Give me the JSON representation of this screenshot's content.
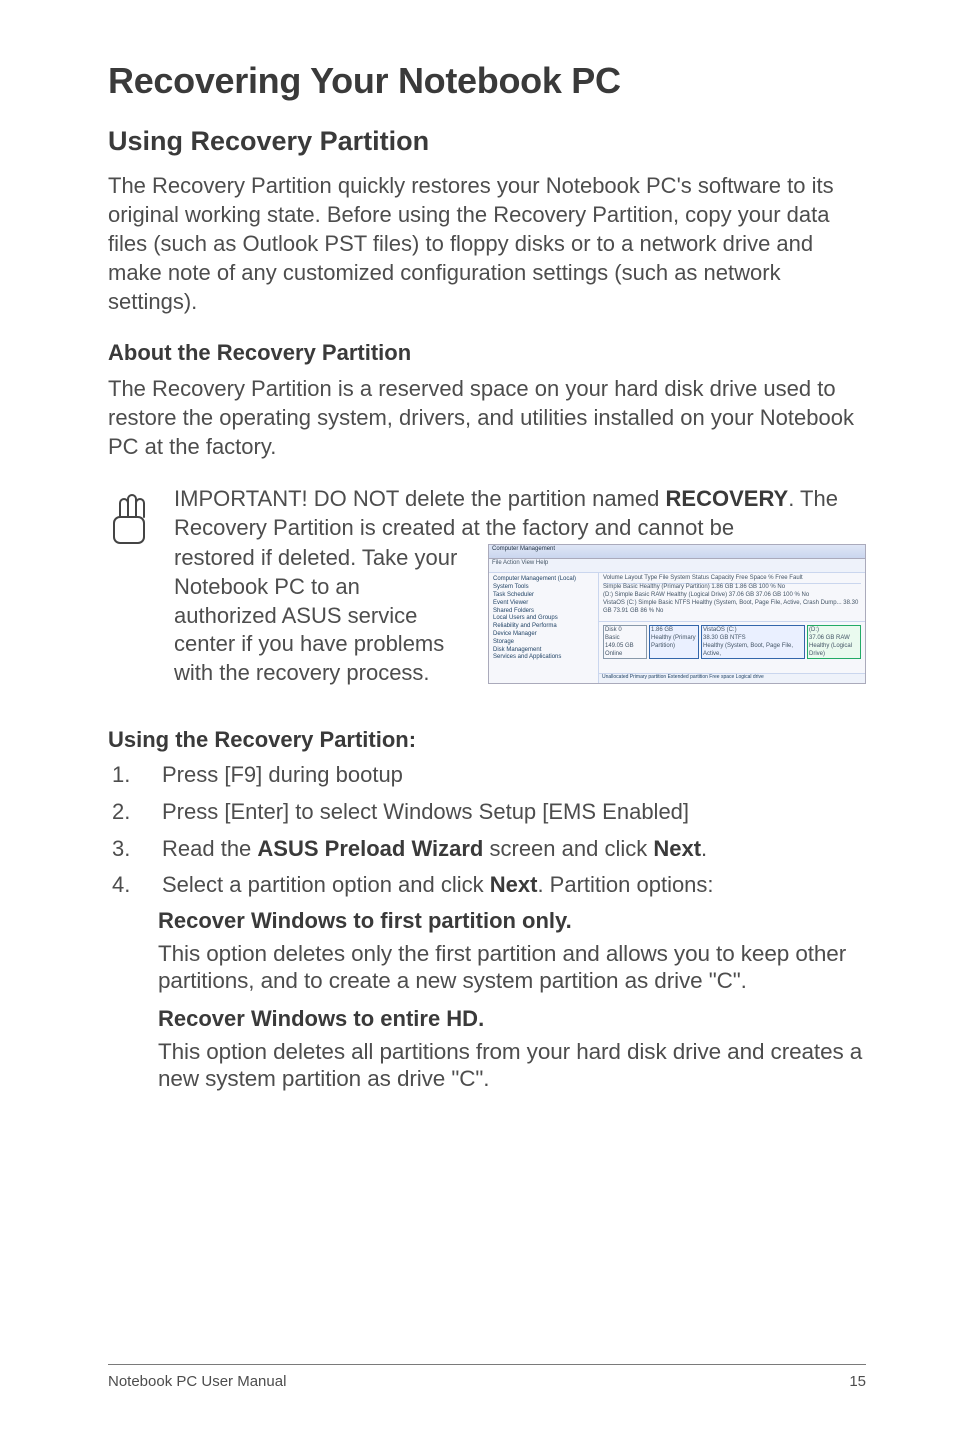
{
  "title": "Recovering Your Notebook PC",
  "h2": "Using Recovery Partition",
  "p1": "The Recovery Partition quickly restores your Notebook PC's software to its original working state. Before using the Recovery Partition, copy your data files (such as Outlook PST files) to floppy disks or to a network drive and make note of any customized configuration settings (such as network settings).",
  "h3a": "About the Recovery Partition",
  "p2": "The Recovery Partition is a reserved space on your hard disk drive used to restore the operating system, drivers, and utilities installed on your Notebook PC at the factory.",
  "callout": {
    "top_pre": "IMPORTANT! DO NOT delete the partition named ",
    "top_strong": "RECOVERY",
    "top_post": ". The Recovery Partition is created at the factory and cannot be ",
    "left": "restored if deleted. Take your Notebook PC to an authorized ASUS service center if you have problems with the recovery process."
  },
  "h3b": "Using the Recovery Partition:",
  "steps": [
    "Press [F9] during bootup",
    "Press [Enter] to select Windows Setup [EMS Enabled]"
  ],
  "step3": {
    "pre": "Read the ",
    "s1": "ASUS Preload Wizard",
    "mid": " screen and click ",
    "s2": "Next",
    "post": "."
  },
  "step4": {
    "pre": "Select a partition option and click ",
    "s1": "Next",
    "post": ". Partition options:"
  },
  "opts": [
    {
      "h": "Recover Windows to first partition only.",
      "b": "This option deletes only the first partition and allows you to keep other partitions, and to create a new system partition as drive \"C\"."
    },
    {
      "h": "Recover Windows to entire HD.",
      "b": "This option deletes all partitions from your hard disk drive and creates a new system partition as drive \"C\"."
    }
  ],
  "footer": {
    "left": "Notebook PC User Manual",
    "right": "15"
  },
  "thumb": {
    "title": "Computer Management",
    "menu": "File  Action  View  Help",
    "tree": [
      "Computer Management (Local)",
      "System Tools",
      "  Task Scheduler",
      "  Event Viewer",
      "  Shared Folders",
      "  Local Users and Groups",
      "  Reliability and Performa",
      "  Device Manager",
      "Storage",
      "  Disk Management",
      "Services and Applications"
    ],
    "cols": "Volume  Layout  Type  File System  Status            Capacity  Free Space  % Free  Fault",
    "rows": [
      "         Simple  Basic           Healthy (Primary Partition)   1.86 GB  1.86 GB  100 %  No",
      "(D:)     Simple  Basic  RAW     Healthy (Logical Drive)      37.06 GB  37.06 GB  100 %  No",
      "VistaOS (C:) Simple Basic NTFS  Healthy (System, Boot, Page File, Active, Crash Dump...  38.30 GB  73.91 GB  86 %  No"
    ],
    "disk": "Disk 0\nBasic\n149.05 GB\nOnline",
    "part1": "1.86 GB\nHealthy (Primary Partition)",
    "part2": "VistaOS (C:)\n38.30 GB NTFS\nHealthy (System, Boot, Page File, Active,",
    "part3": "(D:)\n37.06 GB RAW\nHealthy (Logical Drive)",
    "legend": "Unallocated  Primary partition  Extended partition  Free space  Logical drive"
  }
}
